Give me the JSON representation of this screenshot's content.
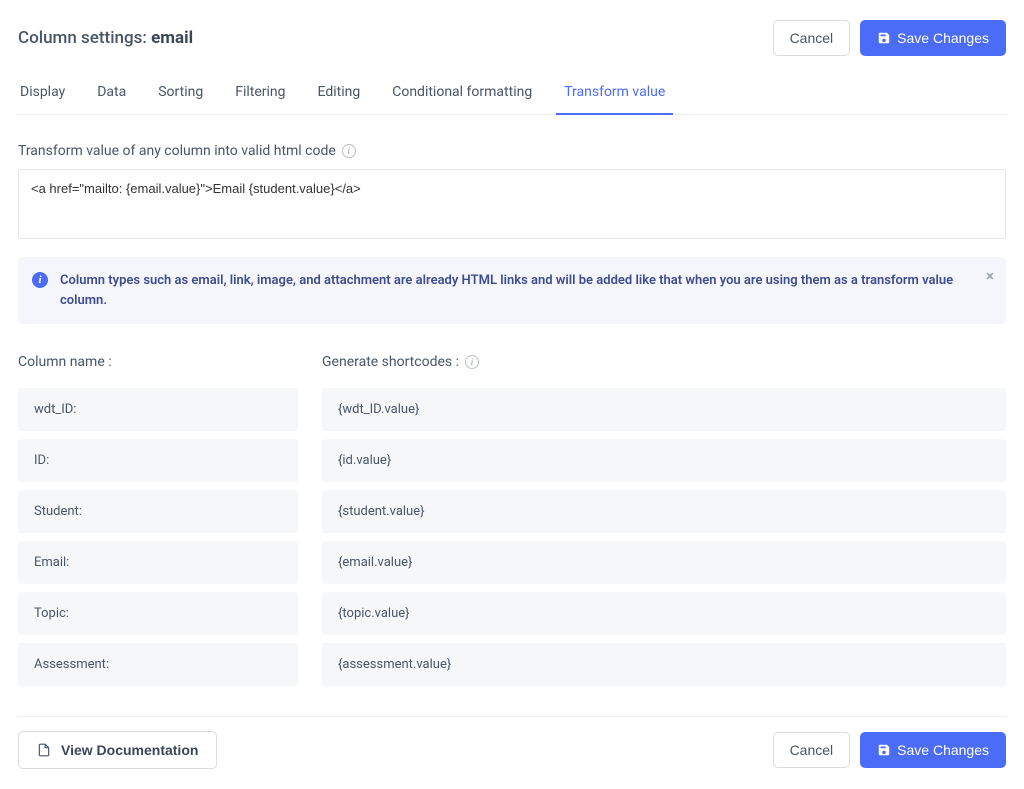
{
  "header": {
    "title_prefix": "Column settings: ",
    "title_subject": "email",
    "cancel_label": "Cancel",
    "save_label": "Save Changes"
  },
  "tabs": [
    {
      "label": "Display"
    },
    {
      "label": "Data"
    },
    {
      "label": "Sorting"
    },
    {
      "label": "Filtering"
    },
    {
      "label": "Editing"
    },
    {
      "label": "Conditional formatting"
    },
    {
      "label": "Transform value",
      "active": true
    }
  ],
  "transform": {
    "label": "Transform value of any column into valid html code",
    "value": "<a href=\"mailto: {email.value}\">Email {student.value}</a>"
  },
  "alert": {
    "text": "Column types such as email, link, image, and attachment are already HTML links and will be added like that when you are using them as a transform value column."
  },
  "columns": {
    "name_header": "Column name :",
    "shortcode_header": "Generate shortcodes :",
    "rows": [
      {
        "name": "wdt_ID:",
        "shortcode": "{wdt_ID.value}"
      },
      {
        "name": "ID:",
        "shortcode": "{id.value}"
      },
      {
        "name": "Student:",
        "shortcode": "{student.value}"
      },
      {
        "name": "Email:",
        "shortcode": "{email.value}"
      },
      {
        "name": "Topic:",
        "shortcode": "{topic.value}"
      },
      {
        "name": "Assessment:",
        "shortcode": "{assessment.value}"
      }
    ]
  },
  "footer": {
    "doc_label": "View Documentation",
    "cancel_label": "Cancel",
    "save_label": "Save Changes"
  }
}
